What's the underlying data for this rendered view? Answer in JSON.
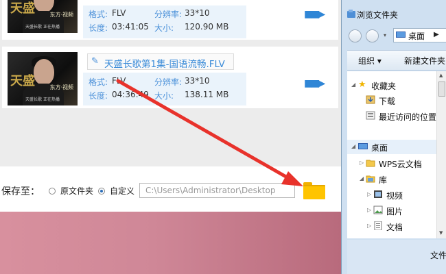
{
  "colors": {
    "accent_blue": "#4a90d9",
    "arrow_red": "#e8322b",
    "folder_yellow": "#ffc400",
    "pink_bg": "#d8909e"
  },
  "files": [
    {
      "title": "",
      "format_label": "格式:",
      "format": "FLV",
      "resolution_label": "分辨率:",
      "resolution": "33*10",
      "duration_label": "长度:",
      "duration": "03:41:05",
      "size_label": "大小:",
      "size": "120.90 MB",
      "thumb_calligraphy": "天盛",
      "thumb_logo": "东方·视频",
      "thumb_caption": "天盛长歌 正在热播"
    },
    {
      "title": "天盛长歌第1集-国语流畅.FLV",
      "format_label": "格式:",
      "format": "FLV",
      "resolution_label": "分辨率:",
      "resolution": "33*10",
      "duration_label": "长度:",
      "duration": "04:36:49",
      "size_label": "大小:",
      "size": "138.11 MB",
      "thumb_calligraphy": "天盛",
      "thumb_logo": "东方·视频",
      "thumb_caption": "天盛长歌 正在热播"
    }
  ],
  "save": {
    "label": "保存至：",
    "option_original": "原文件夹",
    "option_custom": "自定义",
    "selected": "自定义",
    "path": "C:\\Users\\Administrator\\Desktop"
  },
  "dialog": {
    "title": "浏览文件夹",
    "breadcrumb": "桌面",
    "toolbar": {
      "organize": "组织 ▾",
      "new_folder": "新建文件夹"
    },
    "tree": [
      {
        "label": "收藏夹",
        "icon": "star-icon"
      },
      {
        "label": "下载",
        "icon": "download-icon"
      },
      {
        "label": "最近访问的位置",
        "icon": "recent-icon"
      },
      {
        "label": "桌面",
        "icon": "desktop-icon"
      },
      {
        "label": "WPS云文档",
        "icon": "folder-icon"
      },
      {
        "label": "库",
        "icon": "library-icon"
      },
      {
        "label": "视频",
        "icon": "video-icon"
      },
      {
        "label": "图片",
        "icon": "image-icon"
      },
      {
        "label": "文档",
        "icon": "document-icon"
      }
    ],
    "bottom_label": "文件"
  }
}
